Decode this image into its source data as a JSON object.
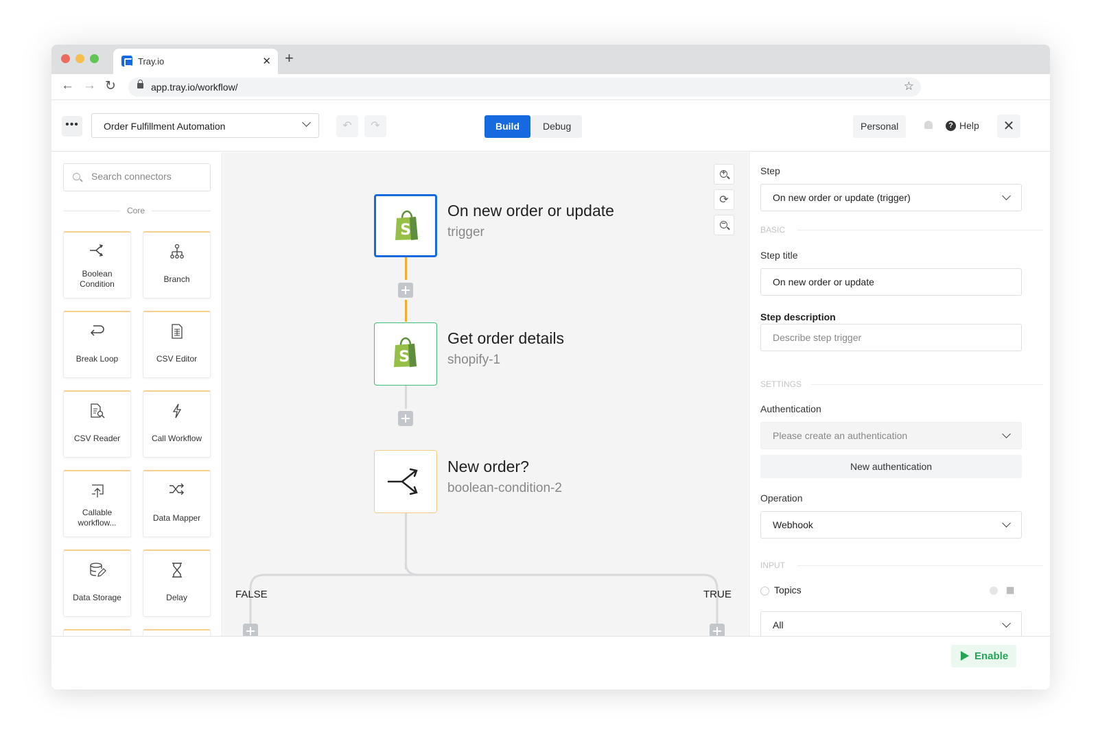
{
  "browser": {
    "tab_title": "Tray.io",
    "url": "app.tray.io/workflow/"
  },
  "header": {
    "workflow_name": "Order Fulfillment Automation",
    "build_label": "Build",
    "debug_label": "Debug",
    "personal_label": "Personal",
    "help_label": "Help"
  },
  "sidebar": {
    "search_placeholder": "Search connectors",
    "section_label": "Core",
    "cards": [
      {
        "label": "Boolean Condition",
        "icon": "branch-arrow-icon"
      },
      {
        "label": "Branch",
        "icon": "tree-icon"
      },
      {
        "label": "Break Loop",
        "icon": "return-arrow-icon"
      },
      {
        "label": "CSV Editor",
        "icon": "spreadsheet-icon"
      },
      {
        "label": "CSV Reader",
        "icon": "document-search-icon"
      },
      {
        "label": "Call Workflow",
        "icon": "lightning-icon"
      },
      {
        "label": "Callable workflow...",
        "icon": "upload-icon"
      },
      {
        "label": "Data Mapper",
        "icon": "shuffle-icon"
      },
      {
        "label": "Data Storage",
        "icon": "database-icon"
      },
      {
        "label": "Delay",
        "icon": "hourglass-icon"
      }
    ]
  },
  "canvas": {
    "nodes": [
      {
        "title": "On new order or update",
        "subtitle": "trigger",
        "icon": "shopify-icon"
      },
      {
        "title": "Get order details",
        "subtitle": "shopify-1",
        "icon": "shopify-icon"
      },
      {
        "title": "New order?",
        "subtitle": "boolean-condition-2",
        "icon": "boolean-branch-icon"
      }
    ],
    "false_label": "FALSE",
    "true_label": "TRUE"
  },
  "panel": {
    "step_label": "Step",
    "step_value": "On new order or update (trigger)",
    "basic_section": "BASIC",
    "step_title_label": "Step title",
    "step_title_value": "On new order or update",
    "step_description_label": "Step description",
    "step_description_placeholder": "Describe step trigger",
    "settings_section": "SETTINGS",
    "authentication_label": "Authentication",
    "authentication_placeholder": "Please create an authentication",
    "new_auth_label": "New authentication",
    "operation_label": "Operation",
    "operation_value": "Webhook",
    "input_section": "INPUT",
    "topics_label": "Topics",
    "topics_value": "All"
  },
  "footer": {
    "enable_label": "Enable"
  }
}
